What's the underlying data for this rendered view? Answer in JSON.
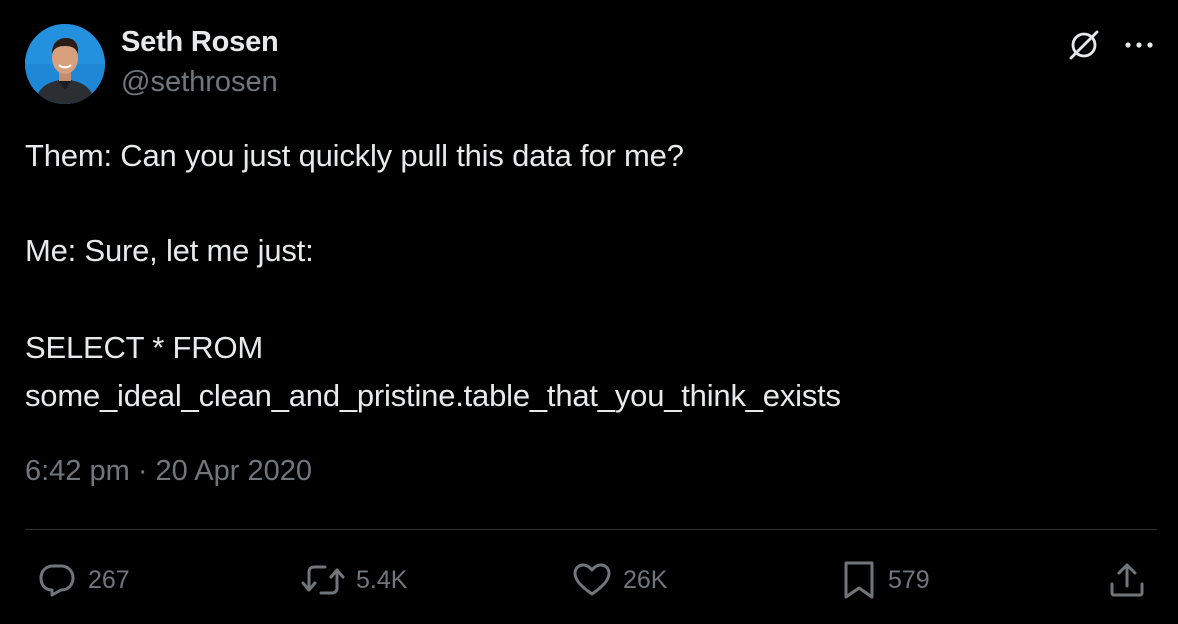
{
  "author": {
    "display_name": "Seth Rosen",
    "handle": "@sethrosen"
  },
  "tweet": {
    "lines": [
      "Them: Can you just quickly pull this data for me?",
      "Me: Sure, let me just:",
      "SELECT * FROM",
      "some_ideal_clean_and_pristine.table_that_you_think_exists"
    ],
    "timestamp": "6:42 pm · 20 Apr 2020"
  },
  "header_icons": [
    "grok-icon",
    "more-icon"
  ],
  "actions": {
    "reply": {
      "icon": "reply-icon",
      "count": "267"
    },
    "retweet": {
      "icon": "retweet-icon",
      "count": "5.4K"
    },
    "like": {
      "icon": "like-icon",
      "count": "26K"
    },
    "bookmark": {
      "icon": "bookmark-icon",
      "count": "579"
    },
    "share": {
      "icon": "share-icon"
    }
  },
  "colors": {
    "background": "#000000",
    "primary_text": "#e7e9ea",
    "secondary_text": "#71767b",
    "divider": "#2f3336"
  }
}
